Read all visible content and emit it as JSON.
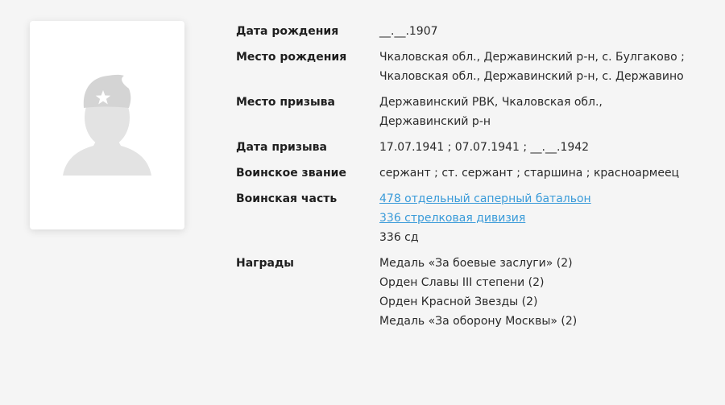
{
  "photo": {
    "icon": "soldier-silhouette-icon",
    "colors": {
      "silhouette": "#e3e3e3",
      "cap": "#d4d4d4",
      "star": "#ffffff"
    }
  },
  "fields": [
    {
      "key": "birth_date",
      "label": "Дата рождения",
      "values": [
        "__.__.1907"
      ]
    },
    {
      "key": "birth_place",
      "label": "Место рождения",
      "values": [
        "Чкаловская обл., Державинский р-н, с. Булгаково ;",
        "Чкаловская обл., Державинский р-н, с. Державино"
      ]
    },
    {
      "key": "draft_place",
      "label": "Место призыва",
      "values": [
        "Державинский РВК, Чкаловская обл.,",
        "Державинский р-н"
      ]
    },
    {
      "key": "draft_date",
      "label": "Дата призыва",
      "values": [
        "17.07.1941 ; 07.07.1941 ; __.__.1942"
      ]
    },
    {
      "key": "rank",
      "label": "Воинское звание",
      "values": [
        "сержант ; ст. сержант ; старшина ; красноармеец"
      ]
    },
    {
      "key": "unit",
      "label": "Воинская часть",
      "values": [
        "478 отдельный саперный батальон",
        "336 стрелковая дивизия",
        "336 сд"
      ],
      "links": [
        true,
        true,
        false
      ]
    },
    {
      "key": "awards",
      "label": "Награды",
      "values": [
        "Медаль «За боевые заслуги» (2)",
        "Орден Славы III степени (2)",
        "Орден Красной Звезды (2)",
        "Медаль «За оборону Москвы» (2)"
      ]
    }
  ],
  "colors": {
    "background": "#f5f5f5",
    "link": "#3a9bd9",
    "text": "#222222"
  }
}
